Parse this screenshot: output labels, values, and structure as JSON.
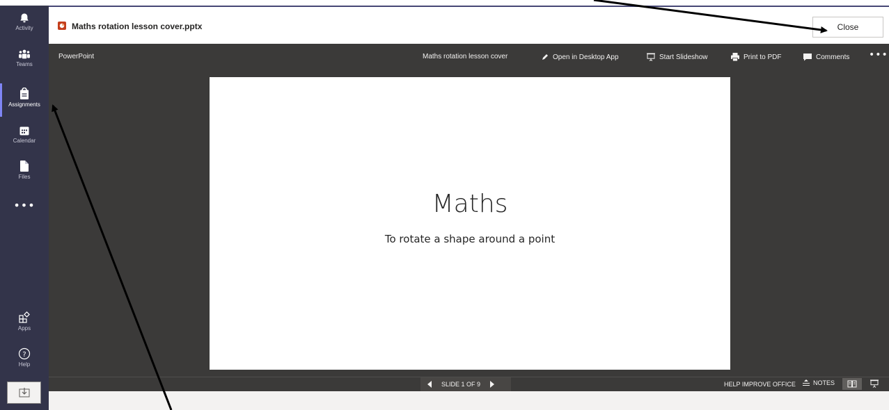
{
  "rail": {
    "items": [
      {
        "label": "Activity",
        "icon": "bell-icon"
      },
      {
        "label": "Teams",
        "icon": "teams-icon"
      },
      {
        "label": "Assignments",
        "icon": "assignments-icon",
        "active": true
      },
      {
        "label": "Calendar",
        "icon": "calendar-icon"
      },
      {
        "label": "Files",
        "icon": "file-icon"
      }
    ],
    "more": "•••",
    "apps_label": "Apps",
    "help_label": "Help"
  },
  "header": {
    "file_title": "Maths rotation lesson cover.pptx",
    "close_label": "Close"
  },
  "toolbar": {
    "app_name": "PowerPoint",
    "doc_name": "Maths rotation lesson cover",
    "open_desktop": "Open in Desktop App",
    "start_slideshow": "Start Slideshow",
    "print_pdf": "Print to PDF",
    "comments": "Comments",
    "more": "•••"
  },
  "slide": {
    "title": "Maths",
    "subtitle": "To rotate a shape around a point"
  },
  "status": {
    "slide_count": "SLIDE 1 OF 9",
    "help_improve": "HELP IMPROVE OFFICE",
    "notes": "NOTES"
  },
  "colors": {
    "rail": "#33344a",
    "accent": "#7f85f5",
    "viewer": "#3b3a39",
    "slide": "#ffffff",
    "ppt_brand": "#c43e1c"
  }
}
